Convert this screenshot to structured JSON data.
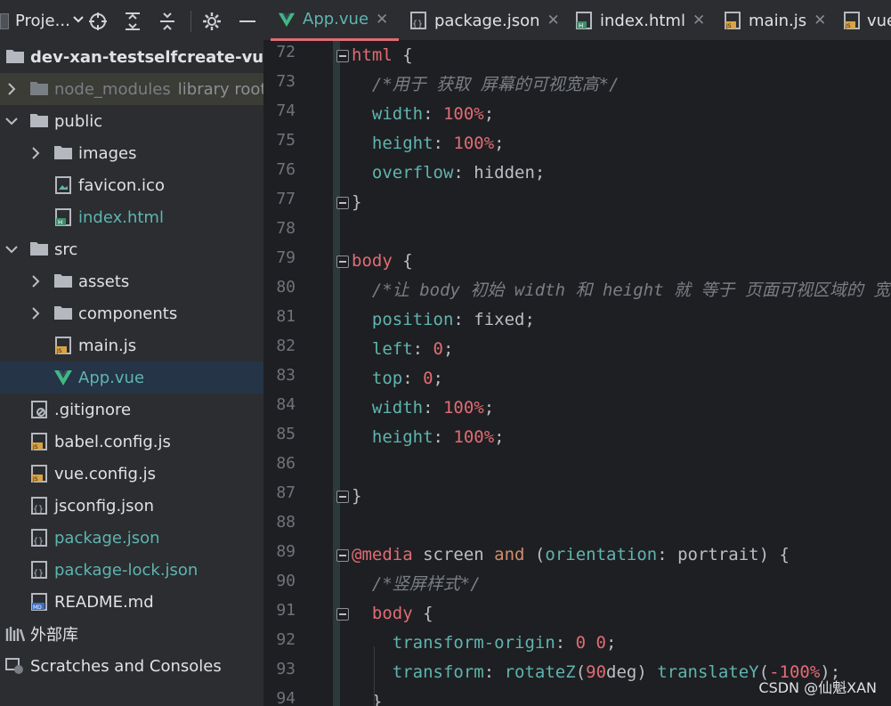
{
  "project": {
    "title": "Proje...",
    "root": "dev-xan-testselfcreate-vuethr"
  },
  "tree": [
    {
      "label": "node_modules",
      "suffix": "library root"
    },
    {
      "label": "public"
    },
    {
      "label": "images"
    },
    {
      "label": "favicon.ico"
    },
    {
      "label": "index.html"
    },
    {
      "label": "src"
    },
    {
      "label": "assets"
    },
    {
      "label": "components"
    },
    {
      "label": "main.js"
    },
    {
      "label": "App.vue"
    },
    {
      "label": ".gitignore"
    },
    {
      "label": "babel.config.js"
    },
    {
      "label": "vue.config.js"
    },
    {
      "label": "jsconfig.json"
    },
    {
      "label": "package.json"
    },
    {
      "label": "package-lock.json"
    },
    {
      "label": "README.md"
    },
    {
      "label": "外部库"
    },
    {
      "label": "Scratches and Consoles"
    }
  ],
  "tabs": [
    {
      "label": "App.vue",
      "icon": "vue-icon",
      "active": true
    },
    {
      "label": "package.json",
      "icon": "json-icon"
    },
    {
      "label": "index.html",
      "icon": "html-icon"
    },
    {
      "label": "main.js",
      "icon": "js-icon"
    },
    {
      "label": "vue",
      "icon": "js-icon"
    }
  ],
  "line_numbers": [
    "72",
    "73",
    "74",
    "75",
    "76",
    "77",
    "78",
    "79",
    "80",
    "81",
    "82",
    "83",
    "84",
    "85",
    "86",
    "87",
    "88",
    "89",
    "90",
    "91",
    "92",
    "93",
    "94"
  ],
  "code_lines": [
    {
      "tokens": [
        [
          "sel-tag",
          "html"
        ],
        [
          "punc",
          " {"
        ]
      ]
    },
    {
      "tokens": [
        [
          "cmt",
          "  /*用于 获取 屏幕的可视宽高*/"
        ]
      ]
    },
    {
      "tokens": [
        [
          "prop",
          "  width"
        ],
        [
          "punc",
          ": "
        ],
        [
          "num",
          "100%"
        ],
        [
          "punc",
          ";"
        ]
      ]
    },
    {
      "tokens": [
        [
          "prop",
          "  height"
        ],
        [
          "punc",
          ": "
        ],
        [
          "num",
          "100%"
        ],
        [
          "punc",
          ";"
        ]
      ]
    },
    {
      "tokens": [
        [
          "prop",
          "  overflow"
        ],
        [
          "punc",
          ": hidden;"
        ]
      ]
    },
    {
      "tokens": [
        [
          "punc",
          "}"
        ]
      ]
    },
    {
      "tokens": []
    },
    {
      "tokens": [
        [
          "sel-tag",
          "body"
        ],
        [
          "punc",
          " {"
        ]
      ]
    },
    {
      "tokens": [
        [
          "cmt",
          "  /*让 body 初始 width 和 height 就 等于 页面可视区域的 宽高"
        ]
      ]
    },
    {
      "tokens": [
        [
          "prop",
          "  position"
        ],
        [
          "punc",
          ": fixed;"
        ]
      ]
    },
    {
      "tokens": [
        [
          "prop",
          "  left"
        ],
        [
          "punc",
          ": "
        ],
        [
          "num",
          "0"
        ],
        [
          "punc",
          ";"
        ]
      ]
    },
    {
      "tokens": [
        [
          "prop",
          "  top"
        ],
        [
          "punc",
          ": "
        ],
        [
          "num",
          "0"
        ],
        [
          "punc",
          ";"
        ]
      ]
    },
    {
      "tokens": [
        [
          "prop",
          "  width"
        ],
        [
          "punc",
          ": "
        ],
        [
          "num",
          "100%"
        ],
        [
          "punc",
          ";"
        ]
      ]
    },
    {
      "tokens": [
        [
          "prop",
          "  height"
        ],
        [
          "punc",
          ": "
        ],
        [
          "num",
          "100%"
        ],
        [
          "punc",
          ";"
        ]
      ]
    },
    {
      "tokens": []
    },
    {
      "tokens": [
        [
          "punc",
          "}"
        ]
      ]
    },
    {
      "tokens": []
    },
    {
      "tokens": [
        [
          "sel-tag",
          "@media"
        ],
        [
          "punc",
          " screen "
        ],
        [
          "kw",
          "and"
        ],
        [
          "punc",
          " ("
        ],
        [
          "prop",
          "orientation"
        ],
        [
          "punc",
          ": portrait) {"
        ]
      ]
    },
    {
      "tokens": [
        [
          "cmt",
          "  /*竖屏样式*/"
        ]
      ]
    },
    {
      "tokens": [
        [
          "sel-tag",
          "  body"
        ],
        [
          "punc",
          " {"
        ]
      ]
    },
    {
      "tokens": [
        [
          "prop",
          "    transform-origin"
        ],
        [
          "punc",
          ": "
        ],
        [
          "num",
          "0 0"
        ],
        [
          "punc",
          ";"
        ]
      ]
    },
    {
      "tokens": [
        [
          "prop",
          "    transform"
        ],
        [
          "punc",
          ": "
        ],
        [
          "prop",
          "rotateZ"
        ],
        [
          "punc",
          "("
        ],
        [
          "num",
          "90"
        ],
        [
          "punc",
          "deg) "
        ],
        [
          "prop",
          "translateY"
        ],
        [
          "punc",
          "("
        ],
        [
          "num",
          "-100%"
        ],
        [
          "punc",
          ");"
        ]
      ]
    },
    {
      "tokens": [
        [
          "punc",
          "  }"
        ]
      ]
    }
  ],
  "watermark": "CSDN @仙魁XAN",
  "colors": {
    "accent": "#e06c75",
    "vue_green": "#41b883",
    "selection": "#253447"
  }
}
